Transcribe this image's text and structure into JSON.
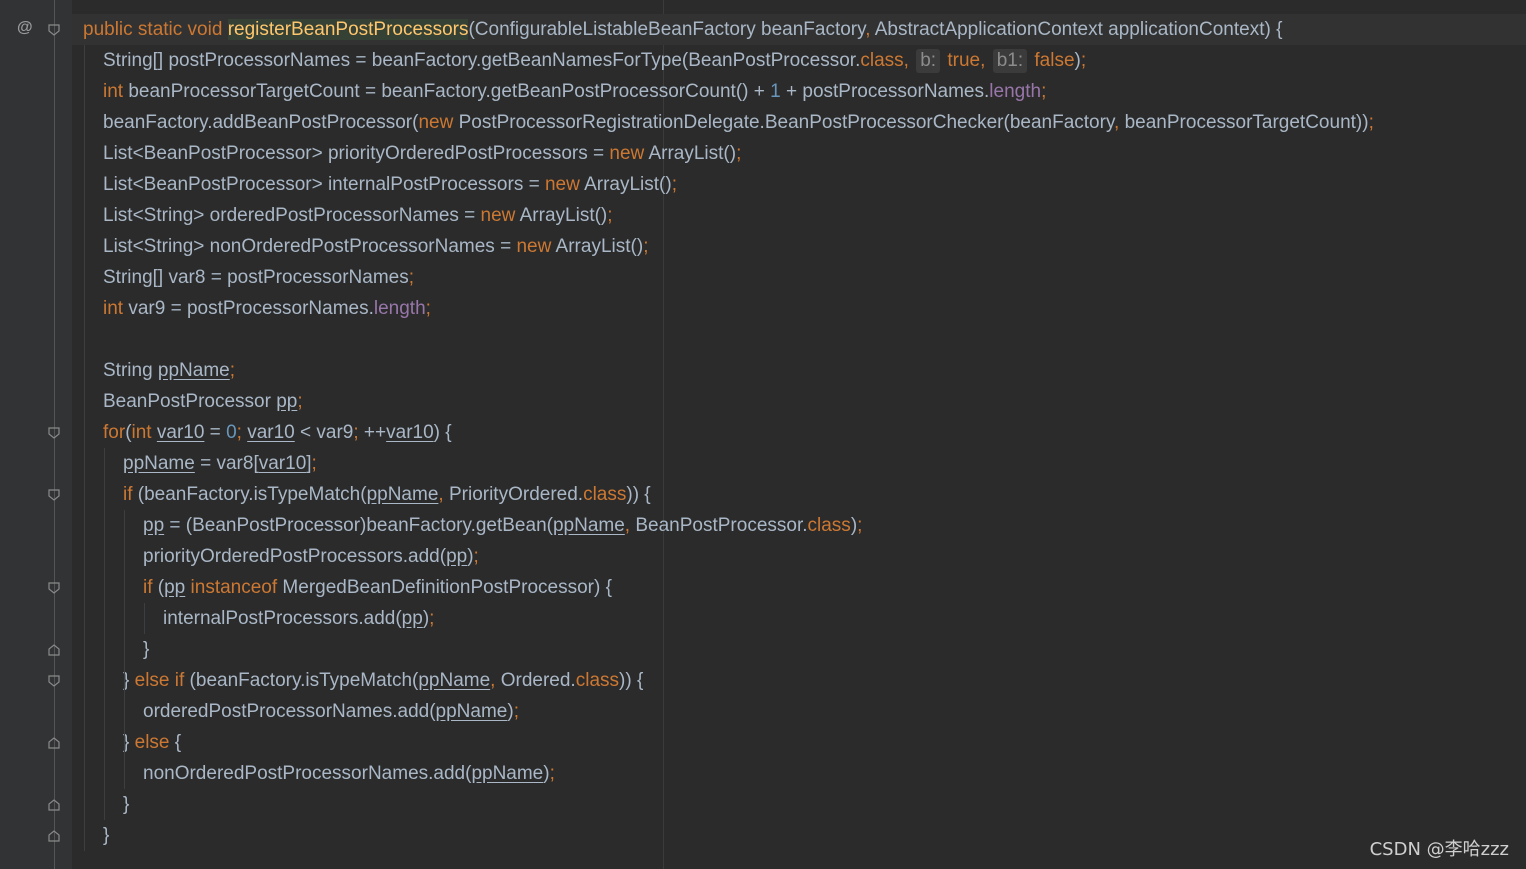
{
  "gutter": {
    "override_marker": "@"
  },
  "watermark": "CSDN @李哈zzz",
  "lines": [
    {
      "indent": 0,
      "tokens": [
        {
          "t": "public static void ",
          "c": "kw"
        },
        {
          "t": "registerBeanPostProcessors",
          "c": "fn-hl"
        },
        {
          "t": "(ConfigurableListableBeanFactory beanFactory",
          "c": ""
        },
        {
          "t": ", ",
          "c": "kw"
        },
        {
          "t": "AbstractApplicationContext applicationContext) {",
          "c": ""
        }
      ]
    },
    {
      "indent": 1,
      "tokens": [
        {
          "t": "String[] postProcessorNames = beanFactory.getBeanNamesForType(BeanPostProcessor.",
          "c": ""
        },
        {
          "t": "class",
          "c": "kw"
        },
        {
          "t": ", ",
          "c": "kw"
        },
        {
          "t": "b:",
          "c": "hint"
        },
        {
          "t": " true",
          "c": "kw"
        },
        {
          "t": ", ",
          "c": "kw"
        },
        {
          "t": "b1:",
          "c": "hint"
        },
        {
          "t": " false",
          "c": "kw"
        },
        {
          "t": ")",
          "c": ""
        },
        {
          "t": ";",
          "c": "kw"
        }
      ]
    },
    {
      "indent": 1,
      "tokens": [
        {
          "t": "int",
          "c": "kw"
        },
        {
          "t": " beanProcessorTargetCount = beanFactory.getBeanPostProcessorCount() + ",
          "c": ""
        },
        {
          "t": "1",
          "c": "num"
        },
        {
          "t": " + postProcessorNames.",
          "c": ""
        },
        {
          "t": "length",
          "c": "fld"
        },
        {
          "t": ";",
          "c": "kw"
        }
      ]
    },
    {
      "indent": 1,
      "tokens": [
        {
          "t": "beanFactory.addBeanPostProcessor(",
          "c": ""
        },
        {
          "t": "new",
          "c": "kw"
        },
        {
          "t": " PostProcessorRegistrationDelegate.BeanPostProcessorChecker(beanFactory",
          "c": ""
        },
        {
          "t": ", ",
          "c": "kw"
        },
        {
          "t": "beanProcessorTargetCount))",
          "c": ""
        },
        {
          "t": ";",
          "c": "kw"
        }
      ]
    },
    {
      "indent": 1,
      "tokens": [
        {
          "t": "List<BeanPostProcessor> priorityOrderedPostProcessors = ",
          "c": ""
        },
        {
          "t": "new",
          "c": "kw"
        },
        {
          "t": " ArrayList()",
          "c": ""
        },
        {
          "t": ";",
          "c": "kw"
        }
      ]
    },
    {
      "indent": 1,
      "tokens": [
        {
          "t": "List<BeanPostProcessor> internalPostProcessors = ",
          "c": ""
        },
        {
          "t": "new",
          "c": "kw"
        },
        {
          "t": " ArrayList()",
          "c": ""
        },
        {
          "t": ";",
          "c": "kw"
        }
      ]
    },
    {
      "indent": 1,
      "tokens": [
        {
          "t": "List<String> orderedPostProcessorNames = ",
          "c": ""
        },
        {
          "t": "new",
          "c": "kw"
        },
        {
          "t": " ArrayList()",
          "c": ""
        },
        {
          "t": ";",
          "c": "kw"
        }
      ]
    },
    {
      "indent": 1,
      "tokens": [
        {
          "t": "List<String> nonOrderedPostProcessorNames = ",
          "c": ""
        },
        {
          "t": "new",
          "c": "kw"
        },
        {
          "t": " ArrayList()",
          "c": ""
        },
        {
          "t": ";",
          "c": "kw"
        }
      ]
    },
    {
      "indent": 1,
      "tokens": [
        {
          "t": "String[] var8 = postProcessorNames",
          "c": ""
        },
        {
          "t": ";",
          "c": "kw"
        }
      ]
    },
    {
      "indent": 1,
      "tokens": [
        {
          "t": "int",
          "c": "kw"
        },
        {
          "t": " var9 = postProcessorNames.",
          "c": ""
        },
        {
          "t": "length",
          "c": "fld"
        },
        {
          "t": ";",
          "c": "kw"
        }
      ]
    },
    {
      "indent": 1,
      "tokens": []
    },
    {
      "indent": 1,
      "tokens": [
        {
          "t": "String ",
          "c": ""
        },
        {
          "t": "ppName",
          "c": "ul"
        },
        {
          "t": ";",
          "c": "kw"
        }
      ]
    },
    {
      "indent": 1,
      "tokens": [
        {
          "t": "BeanPostProcessor ",
          "c": ""
        },
        {
          "t": "pp",
          "c": "ul"
        },
        {
          "t": ";",
          "c": "kw"
        }
      ]
    },
    {
      "indent": 1,
      "tokens": [
        {
          "t": "for",
          "c": "kw"
        },
        {
          "t": "(",
          "c": ""
        },
        {
          "t": "int",
          "c": "kw"
        },
        {
          "t": " ",
          "c": ""
        },
        {
          "t": "var10",
          "c": "ul"
        },
        {
          "t": " = ",
          "c": ""
        },
        {
          "t": "0",
          "c": "num"
        },
        {
          "t": "; ",
          "c": "kw"
        },
        {
          "t": "var10",
          "c": "ul"
        },
        {
          "t": " < var9",
          "c": ""
        },
        {
          "t": "; ",
          "c": "kw"
        },
        {
          "t": "++",
          "c": ""
        },
        {
          "t": "var10",
          "c": "ul"
        },
        {
          "t": ") {",
          "c": ""
        }
      ]
    },
    {
      "indent": 2,
      "tokens": [
        {
          "t": "ppName",
          "c": "ul"
        },
        {
          "t": " = var8[",
          "c": ""
        },
        {
          "t": "var10",
          "c": "ul"
        },
        {
          "t": "]",
          "c": ""
        },
        {
          "t": ";",
          "c": "kw"
        }
      ]
    },
    {
      "indent": 2,
      "tokens": [
        {
          "t": "if",
          "c": "kw"
        },
        {
          "t": " (beanFactory.isTypeMatch(",
          "c": ""
        },
        {
          "t": "ppName",
          "c": "ul"
        },
        {
          "t": ", ",
          "c": "kw"
        },
        {
          "t": "PriorityOrdered.",
          "c": ""
        },
        {
          "t": "class",
          "c": "kw"
        },
        {
          "t": ")) {",
          "c": ""
        }
      ]
    },
    {
      "indent": 3,
      "tokens": [
        {
          "t": "pp",
          "c": "ul"
        },
        {
          "t": " = (BeanPostProcessor)beanFactory.getBean(",
          "c": ""
        },
        {
          "t": "ppName",
          "c": "ul"
        },
        {
          "t": ", ",
          "c": "kw"
        },
        {
          "t": "BeanPostProcessor.",
          "c": ""
        },
        {
          "t": "class",
          "c": "kw"
        },
        {
          "t": ")",
          "c": ""
        },
        {
          "t": ";",
          "c": "kw"
        }
      ]
    },
    {
      "indent": 3,
      "tokens": [
        {
          "t": "priorityOrderedPostProcessors.add(",
          "c": ""
        },
        {
          "t": "pp",
          "c": "ul"
        },
        {
          "t": ")",
          "c": ""
        },
        {
          "t": ";",
          "c": "kw"
        }
      ]
    },
    {
      "indent": 3,
      "tokens": [
        {
          "t": "if",
          "c": "kw"
        },
        {
          "t": " (",
          "c": ""
        },
        {
          "t": "pp",
          "c": "ul"
        },
        {
          "t": " ",
          "c": ""
        },
        {
          "t": "instanceof",
          "c": "kw"
        },
        {
          "t": " MergedBeanDefinitionPostProcessor) {",
          "c": ""
        }
      ]
    },
    {
      "indent": 4,
      "tokens": [
        {
          "t": "internalPostProcessors.add(",
          "c": ""
        },
        {
          "t": "pp",
          "c": "ul"
        },
        {
          "t": ")",
          "c": ""
        },
        {
          "t": ";",
          "c": "kw"
        }
      ]
    },
    {
      "indent": 3,
      "tokens": [
        {
          "t": "}",
          "c": ""
        }
      ]
    },
    {
      "indent": 2,
      "tokens": [
        {
          "t": "} ",
          "c": ""
        },
        {
          "t": "else if",
          "c": "kw"
        },
        {
          "t": " (beanFactory.isTypeMatch(",
          "c": ""
        },
        {
          "t": "ppName",
          "c": "ul"
        },
        {
          "t": ", ",
          "c": "kw"
        },
        {
          "t": "Ordered.",
          "c": ""
        },
        {
          "t": "class",
          "c": "kw"
        },
        {
          "t": ")) {",
          "c": ""
        }
      ]
    },
    {
      "indent": 3,
      "tokens": [
        {
          "t": "orderedPostProcessorNames.add(",
          "c": ""
        },
        {
          "t": "ppName",
          "c": "ul"
        },
        {
          "t": ")",
          "c": ""
        },
        {
          "t": ";",
          "c": "kw"
        }
      ]
    },
    {
      "indent": 2,
      "tokens": [
        {
          "t": "} ",
          "c": ""
        },
        {
          "t": "else",
          "c": "kw"
        },
        {
          "t": " {",
          "c": ""
        }
      ]
    },
    {
      "indent": 3,
      "tokens": [
        {
          "t": "nonOrderedPostProcessorNames.add(",
          "c": ""
        },
        {
          "t": "ppName",
          "c": "ul"
        },
        {
          "t": ")",
          "c": ""
        },
        {
          "t": ";",
          "c": "kw"
        }
      ]
    },
    {
      "indent": 2,
      "tokens": [
        {
          "t": "}",
          "c": ""
        }
      ]
    },
    {
      "indent": 1,
      "tokens": [
        {
          "t": "}",
          "c": ""
        }
      ]
    }
  ],
  "fold_markers": [
    {
      "line": 0,
      "kind": "open"
    },
    {
      "line": 13,
      "kind": "open"
    },
    {
      "line": 15,
      "kind": "open"
    },
    {
      "line": 18,
      "kind": "open"
    },
    {
      "line": 20,
      "kind": "close"
    },
    {
      "line": 21,
      "kind": "open"
    },
    {
      "line": 23,
      "kind": "close"
    },
    {
      "line": 25,
      "kind": "close"
    },
    {
      "line": 26,
      "kind": "close"
    }
  ]
}
